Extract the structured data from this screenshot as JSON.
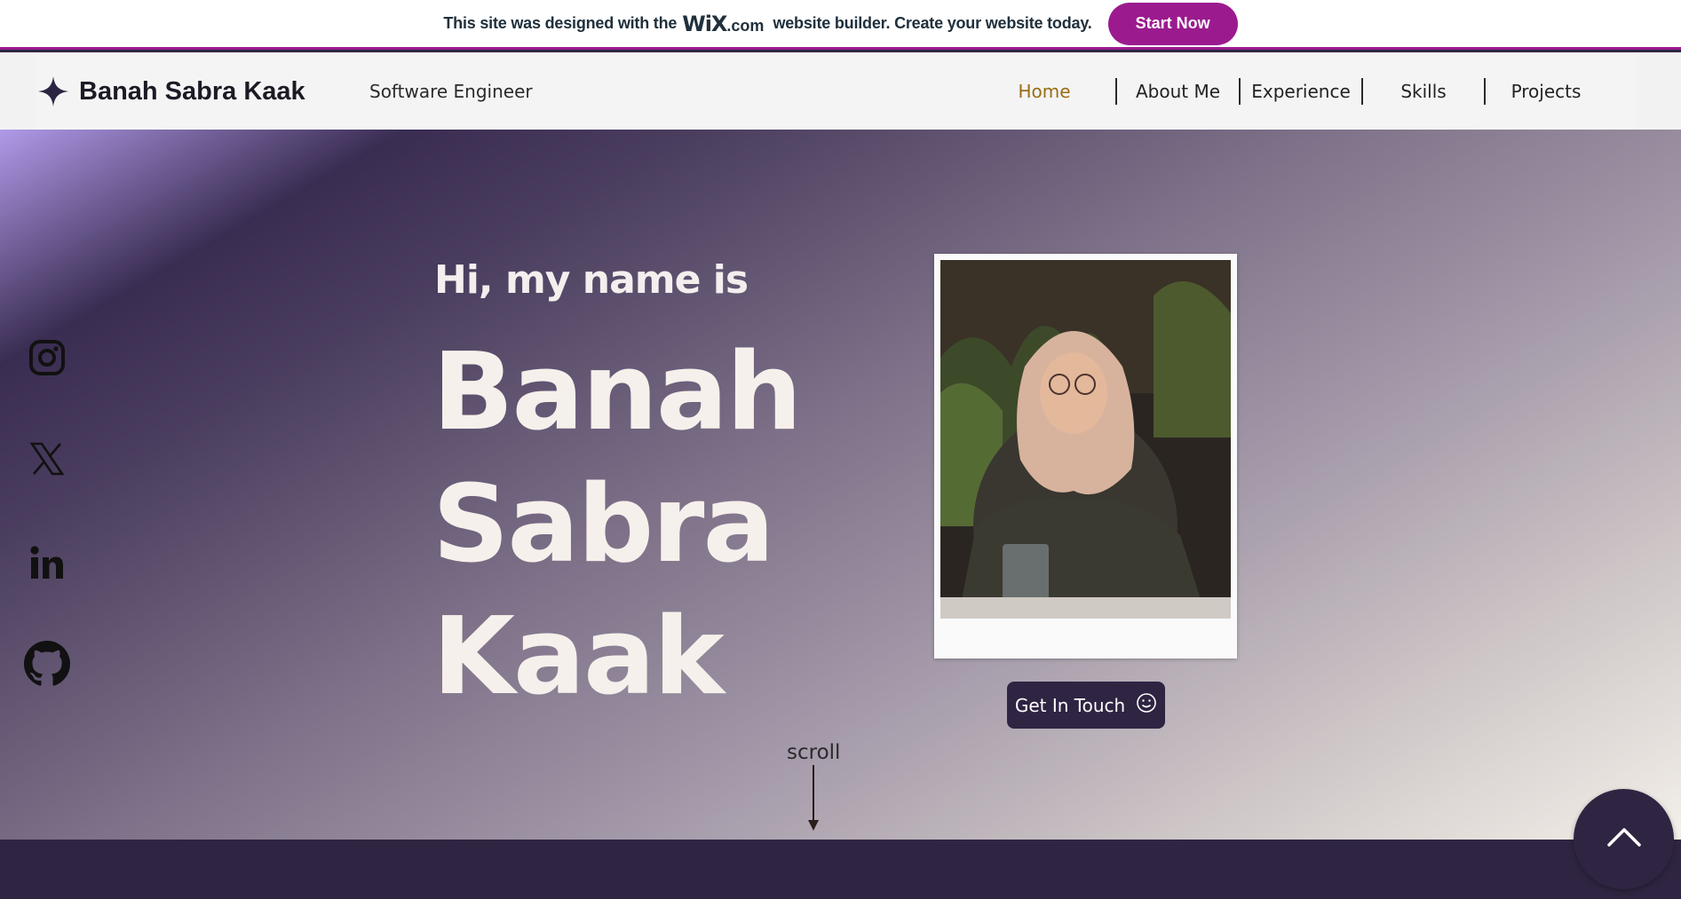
{
  "banner": {
    "text_before": "This site was designed with the",
    "wix_logo": "WiX",
    "dotcom": ".com",
    "text_after": "website builder. Create your website today.",
    "cta_label": "Start Now"
  },
  "header": {
    "brand_name": "Banah Sabra Kaak",
    "tagline": "Software Engineer",
    "nav": [
      {
        "label": "Home",
        "active": true
      },
      {
        "label": "About Me",
        "active": false
      },
      {
        "label": "Experience",
        "active": false
      },
      {
        "label": "Skills",
        "active": false
      },
      {
        "label": "Projects",
        "active": false
      }
    ]
  },
  "social": [
    {
      "icon": "instagram-icon"
    },
    {
      "icon": "x-twitter-icon"
    },
    {
      "icon": "linkedin-icon"
    },
    {
      "icon": "github-icon"
    }
  ],
  "hero": {
    "greeting": "Hi, my name is",
    "name_lines": [
      "Banah",
      "Sabra",
      "Kaak"
    ],
    "cta_label": "Get In Touch",
    "scroll_label": "scroll"
  },
  "colors": {
    "brand_purple": "#9b1b8e",
    "dark_purple": "#2f2542",
    "active_nav": "#9a6d14"
  }
}
